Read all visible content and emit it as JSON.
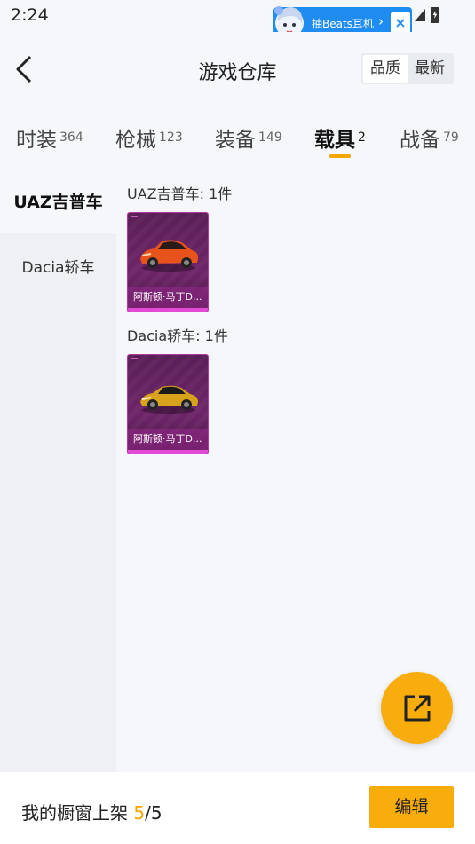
{
  "status_bar": {
    "time": "2:24"
  },
  "promo": {
    "label": "抽Beats耳机",
    "chevron": "›",
    "close": "×"
  },
  "header": {
    "title": "游戏仓库",
    "sort_options": [
      "品质",
      "最新"
    ],
    "active_sort": "品质"
  },
  "tabs": [
    {
      "label": "时装",
      "count": "364"
    },
    {
      "label": "枪械",
      "count": "123"
    },
    {
      "label": "装备",
      "count": "149"
    },
    {
      "label": "载具",
      "count": "2"
    },
    {
      "label": "战备",
      "count": "79"
    }
  ],
  "active_tab": "载具",
  "sidebar": {
    "items": [
      "UAZ吉普车",
      "Dacia轿车"
    ],
    "active": "UAZ吉普车"
  },
  "groups": [
    {
      "title": "UAZ吉普车: 1件",
      "items": [
        {
          "name": "阿斯顿·马丁D...",
          "car_color": "#e8531c"
        }
      ]
    },
    {
      "title": "Dacia轿车: 1件",
      "items": [
        {
          "name": "阿斯顿·马丁D...",
          "car_color": "#d9a21c"
        }
      ]
    }
  ],
  "bottom_bar": {
    "label": "我的橱窗上架 ",
    "current": "5",
    "total": "/5",
    "edit_label": "编辑"
  },
  "colors": {
    "accent": "#f8ad0c",
    "promo": "#1e8cf0",
    "card": "#6e2569"
  },
  "icons": {
    "back": "back-icon",
    "share": "share-icon",
    "signal": "signal-icon",
    "battery": "battery-icon"
  }
}
